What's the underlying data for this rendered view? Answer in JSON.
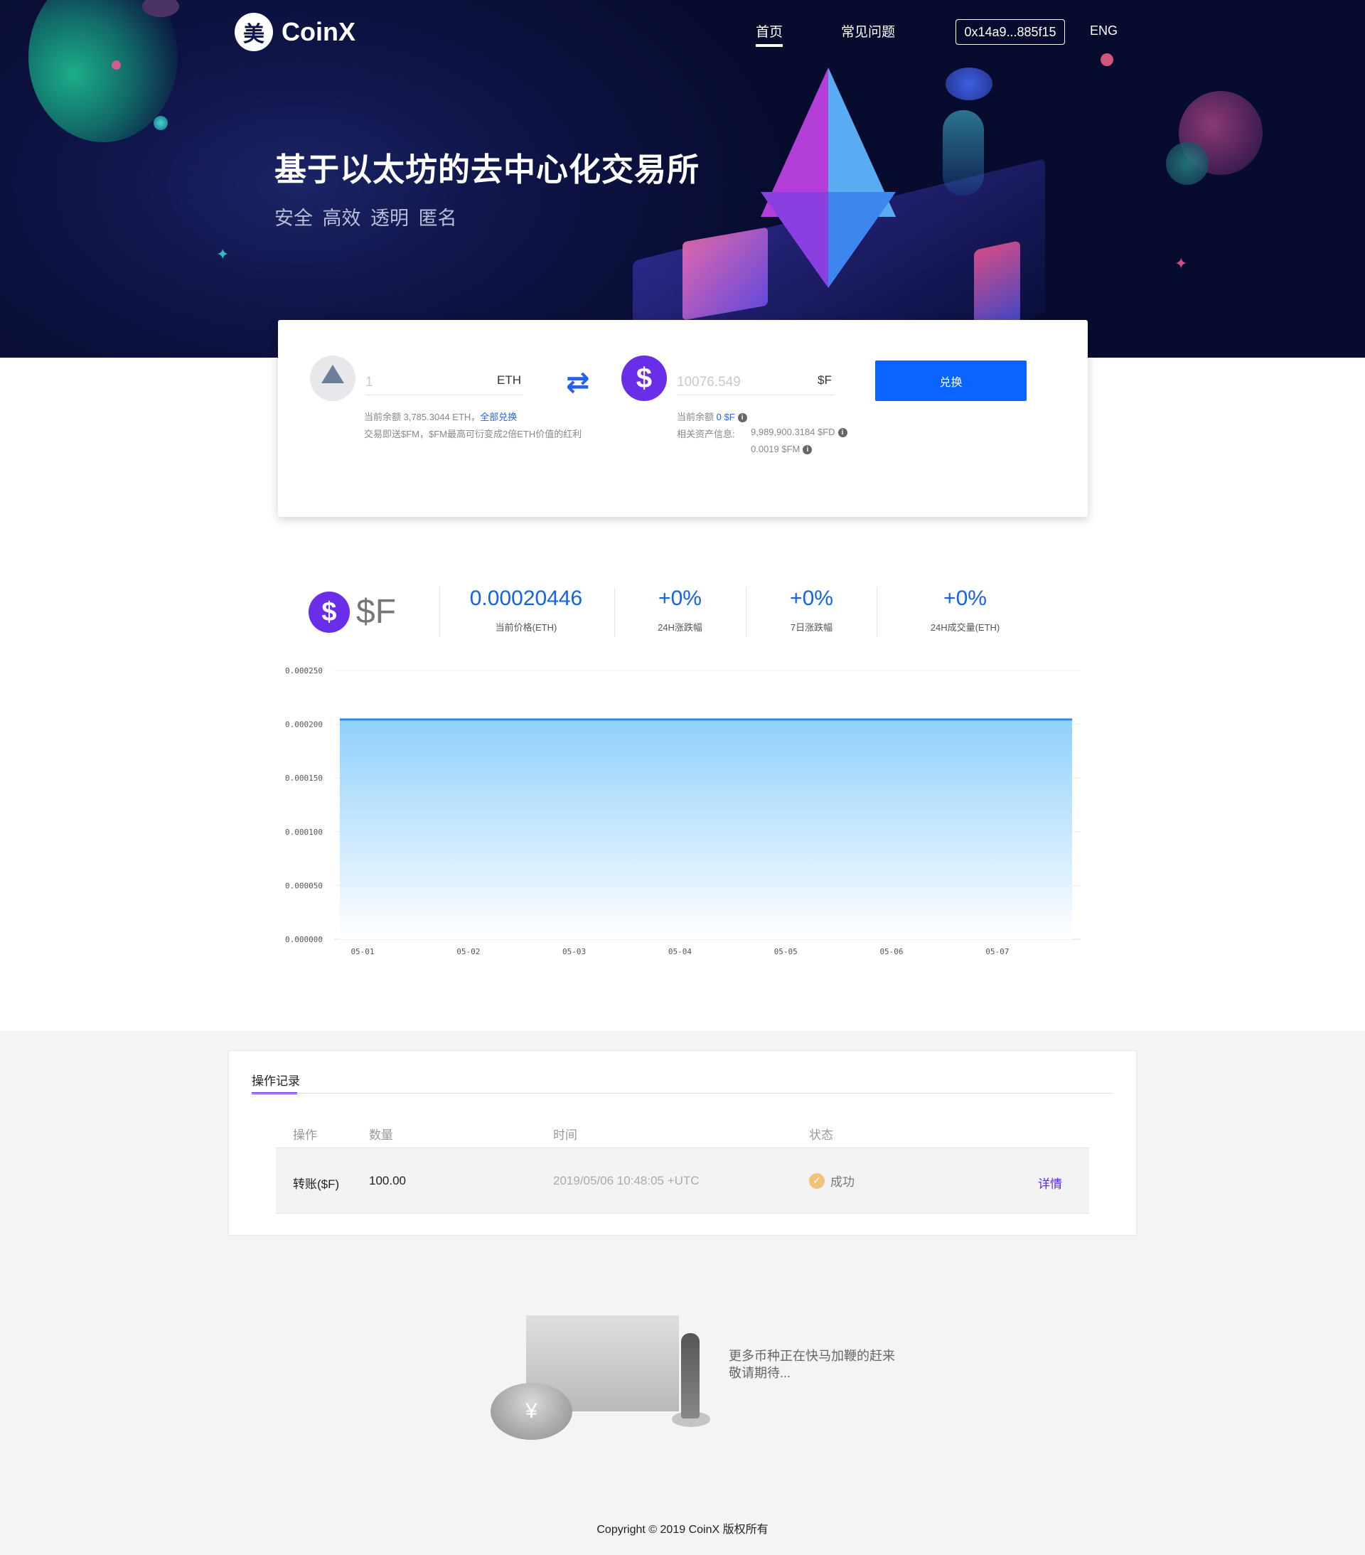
{
  "header": {
    "logo_glyph": "美",
    "logo_text": "CoinX",
    "nav": [
      "首页",
      "常见问题"
    ],
    "wallet_address": "0x14a9...885f15",
    "language": "ENG"
  },
  "hero": {
    "title": "基于以太坊的去中心化交易所",
    "subtitle": "安全  高效  透明  匿名"
  },
  "exchange": {
    "from_value": "1",
    "from_unit": "ETH",
    "to_value": "10076.549",
    "to_unit": "$F",
    "button_label": "兑换",
    "from_balance_prefix": "当前余额 3,785.3044 ETH，",
    "from_balance_link": "全部兑换",
    "from_note": "交易即送$FM，$FM最高可衍变成2倍ETH价值的红利",
    "to_balance_prefix": "当前余额 ",
    "to_balance_value": "0 $F",
    "assets_label": "相关资产信息:",
    "assets_fd": "9,989,900.3184 $FD",
    "assets_fm": "0.0019 $FM"
  },
  "stats": {
    "token_name": "$F",
    "token_glyph": "$",
    "items": [
      {
        "value": "0.00020446",
        "label": "当前价格(ETH)"
      },
      {
        "value": "+0%",
        "label": "24H涨跌幅"
      },
      {
        "value": "+0%",
        "label": "7日涨跌幅"
      },
      {
        "value": "+0%",
        "label": "24H成交量(ETH)"
      }
    ]
  },
  "chart_data": {
    "type": "area",
    "title": "",
    "xlabel": "",
    "ylabel": "",
    "categories": [
      "05-01",
      "05-02",
      "05-03",
      "05-04",
      "05-05",
      "05-06",
      "05-07"
    ],
    "values": [
      0.00020446,
      0.00020446,
      0.00020446,
      0.00020446,
      0.00020446,
      0.00020446,
      0.00020446
    ],
    "ylim": [
      0,
      0.00025
    ],
    "yticks": [
      "0.000250",
      "0.000200",
      "0.000150",
      "0.000100",
      "0.000050",
      "0.000000"
    ],
    "grid": true,
    "line_color": "#2b8fe6",
    "fill_color": "#8fd0fb"
  },
  "records": {
    "tab": "操作记录",
    "columns": [
      "操作",
      "数量",
      "时间",
      "状态"
    ],
    "rows": [
      {
        "action": "转账($F)",
        "amount": "100.00",
        "time": "2019/05/06 10:48:05 +UTC",
        "status": "成功",
        "detail": "详情"
      }
    ]
  },
  "coming_soon": {
    "line1": "更多币种正在快马加鞭的赶来",
    "line2": "敬请期待...",
    "coin_glyph": "¥"
  },
  "footer": {
    "copyright": "Copyright © 2019  CoinX  版权所有"
  },
  "colors": {
    "accent_blue": "#0a64ff",
    "token_purple": "#6a2ee8",
    "tab_purple": "#5b2de0"
  }
}
